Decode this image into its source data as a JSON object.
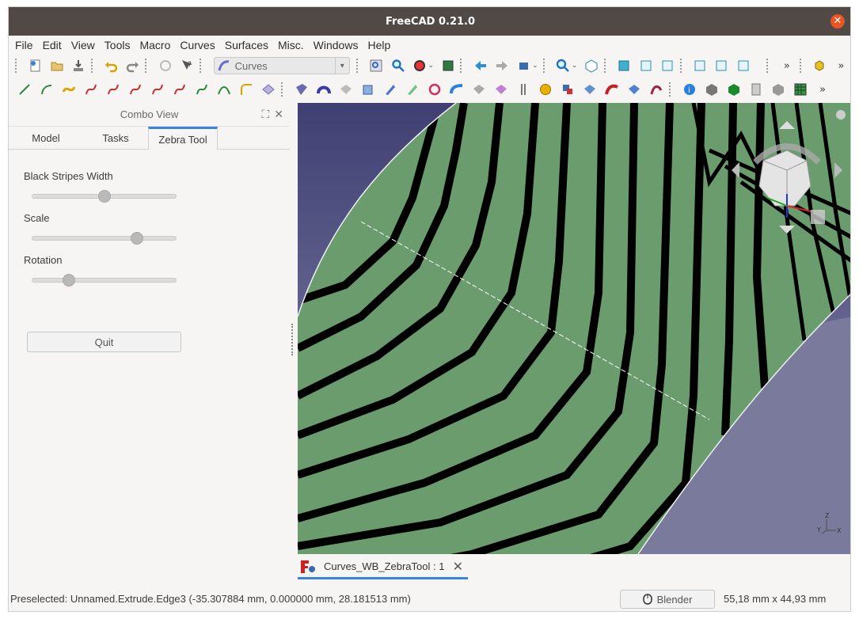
{
  "window": {
    "title": "FreeCAD 0.21.0",
    "close_icon": "close-icon"
  },
  "menu": [
    "File",
    "Edit",
    "View",
    "Tools",
    "Macro",
    "Curves",
    "Surfaces",
    "Misc.",
    "Windows",
    "Help"
  ],
  "toolbar": {
    "workbench_value": "Curves",
    "overflow": "»"
  },
  "combo_view": {
    "title": "Combo View",
    "tabs": [
      {
        "label": "Model"
      },
      {
        "label": "Tasks"
      },
      {
        "label": "Zebra Tool"
      }
    ],
    "active_tab": "Zebra Tool",
    "sliders": [
      {
        "label": "Black Stripes Width",
        "value": 0.5
      },
      {
        "label": "Scale",
        "value": 0.75
      },
      {
        "label": "Rotation",
        "value": 0.23
      }
    ],
    "quit_label": "Quit"
  },
  "document_tab": {
    "label": "Curves_WB_ZebraTool : 1"
  },
  "status": {
    "message": "Preselected: Unnamed.Extrude.Edge3 (-35.307884 mm, 0.000000 mm, 28.181513 mm)",
    "navigation_style": "Blender",
    "dimensions": "55,18 mm x 44,93 mm"
  },
  "colors": {
    "accent": "#3584e4",
    "titlebar": "#504945",
    "surface_green": "#6a9c6e",
    "stripe": "#000000",
    "background_top": "#3f3f72"
  }
}
